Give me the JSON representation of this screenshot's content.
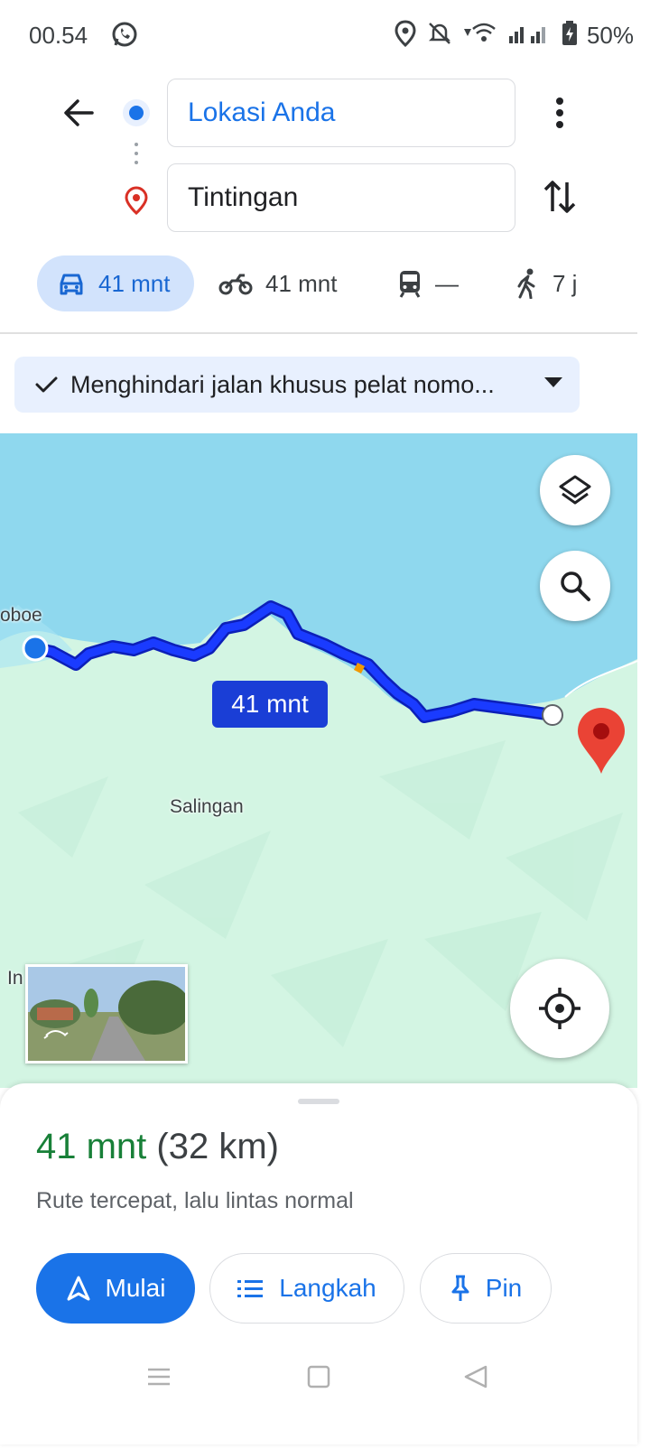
{
  "status": {
    "time": "00.54",
    "battery": "50%"
  },
  "directions": {
    "origin": "Lokasi Anda",
    "destination": "Tintingan"
  },
  "modes": [
    {
      "name": "car",
      "label": "41 mnt",
      "active": true
    },
    {
      "name": "motorcycle",
      "label": "41 mnt"
    },
    {
      "name": "transit",
      "label": "—"
    },
    {
      "name": "walk",
      "label": "7 j"
    }
  ],
  "filter_chip": "Menghindari jalan khusus pelat nomo...",
  "map": {
    "labels": {
      "oboe": "oboe",
      "salingan": "Salingan",
      "in": "In"
    },
    "route_label": "41 mnt",
    "colors": {
      "water": "#8fd8ee",
      "land": "#d3f5e3",
      "route": "#1a3bff",
      "destination_pin": "#ea4335"
    }
  },
  "summary": {
    "time": "41 mnt",
    "distance": "(32 km)",
    "subtitle": "Rute tercepat, lalu lintas normal"
  },
  "buttons": {
    "start": "Mulai",
    "steps": "Langkah",
    "pin": "Pin"
  }
}
